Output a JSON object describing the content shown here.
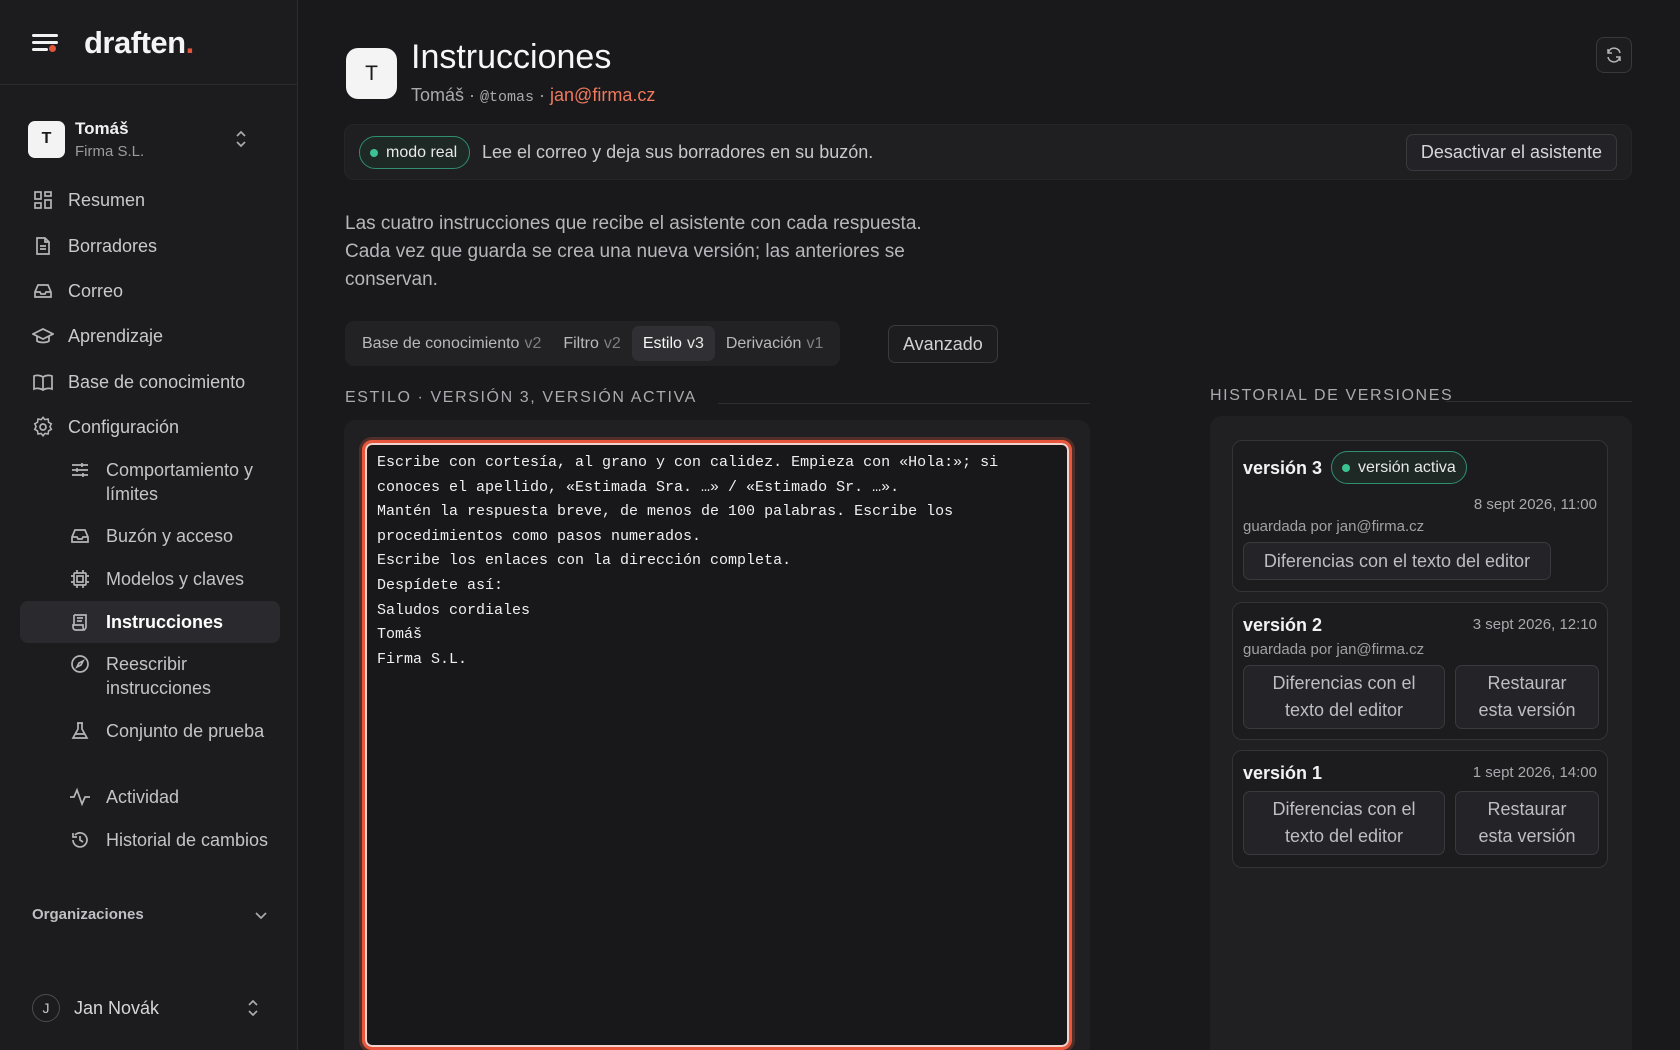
{
  "brand": {
    "name": "draften",
    "dot": "."
  },
  "account": {
    "initial": "T",
    "name": "Tomáš",
    "org": "Firma S.L."
  },
  "nav": {
    "resumen": "Resumen",
    "borradores": "Borradores",
    "correo": "Correo",
    "aprendizaje": "Aprendizaje",
    "base": "Base de conocimiento",
    "configuracion": "Configuración"
  },
  "subnav": {
    "comportamiento": "Comportamiento y límites",
    "buzon": "Buzón y acceso",
    "modelos": "Modelos y claves",
    "instrucciones": "Instrucciones",
    "reescribir": "Reescribir instrucciones",
    "conjunto": "Conjunto de prueba",
    "actividad": "Actividad",
    "historial": "Historial de cambios"
  },
  "organizations_label": "Organizaciones",
  "user": {
    "initial": "J",
    "name": "Jan Novák"
  },
  "page": {
    "avatar": "T",
    "title": "Instrucciones",
    "meta_name": "Tomáš · ",
    "meta_handle": "@tomas",
    "meta_sep": " · ",
    "meta_email": "jan@firma.cz"
  },
  "banner": {
    "mode": "modo real",
    "text": "Lee el correo y deja sus borradores en su buzón.",
    "deactivate": "Desactivar el asistente"
  },
  "description": "Las cuatro instrucciones que recibe el asistente con cada respuesta. Cada vez que guarda se crea una nueva versión; las anteriores se conservan.",
  "tabs": [
    {
      "label": "Base de conocimiento",
      "version": "v2"
    },
    {
      "label": "Filtro",
      "version": "v2"
    },
    {
      "label": "Estilo",
      "version": "v3"
    },
    {
      "label": "Derivación",
      "version": "v1"
    }
  ],
  "advanced_label": "Avanzado",
  "editor": {
    "heading": "ESTILO · VERSIÓN 3, VERSIÓN ACTIVA",
    "content": "Escribe con cortesía, al grano y con calidez. Empieza con «Hola:»; si conoces el apellido, «Estimada Sra. …» / «Estimado Sr. …».\nMantén la respuesta breve, de menos de 100 palabras. Escribe los procedimientos como pasos numerados.\nEscribe los enlaces con la dirección completa.\nDespídete así:\nSaludos cordiales\nTomáš\nFirma S.L."
  },
  "history": {
    "heading": "HISTORIAL DE VERSIONES",
    "active_label": "versión activa",
    "versions": [
      {
        "title": "versión 3",
        "date": "8 sept 2026, 11:00",
        "by": "guardada por jan@firma.cz",
        "diff": "Diferencias con el texto del editor"
      },
      {
        "title": "versión 2",
        "date": "3 sept 2026, 12:10",
        "by": "guardada por jan@firma.cz",
        "diff": "Diferencias con el texto del editor",
        "restore": "Restaurar esta versión"
      },
      {
        "title": "versión 1",
        "date": "1 sept 2026, 14:00",
        "diff": "Diferencias con el texto del editor",
        "restore": "Restaurar esta versión"
      }
    ]
  },
  "colors": {
    "accent": "#e2553b",
    "email": "#ef7a5d",
    "active_green": "#3dc293"
  }
}
